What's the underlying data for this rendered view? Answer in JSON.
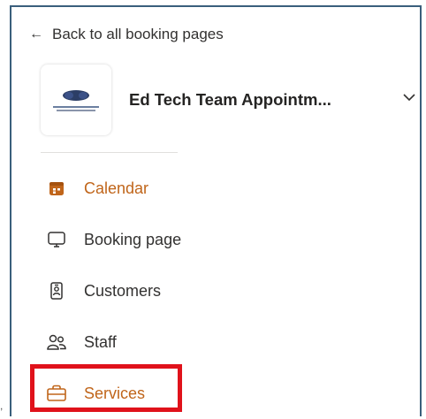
{
  "corner_mark": ",",
  "back_link": {
    "arrow": "←",
    "label": "Back to all booking pages"
  },
  "header": {
    "team_name": "Ed Tech Team Appointm...",
    "logo_icon": "college-logo-icon"
  },
  "nav": {
    "items": [
      {
        "label": "Calendar",
        "icon": "calendar-icon",
        "active": true
      },
      {
        "label": "Booking page",
        "icon": "monitor-icon",
        "active": false
      },
      {
        "label": "Customers",
        "icon": "contact-card-icon",
        "active": false
      },
      {
        "label": "Staff",
        "icon": "people-icon",
        "active": false
      },
      {
        "label": "Services",
        "icon": "briefcase-icon",
        "active": false,
        "highlighted": true
      }
    ]
  },
  "colors": {
    "accent": "#c0651a",
    "highlight": "#e0121b",
    "frame": "#3a5f7c"
  }
}
